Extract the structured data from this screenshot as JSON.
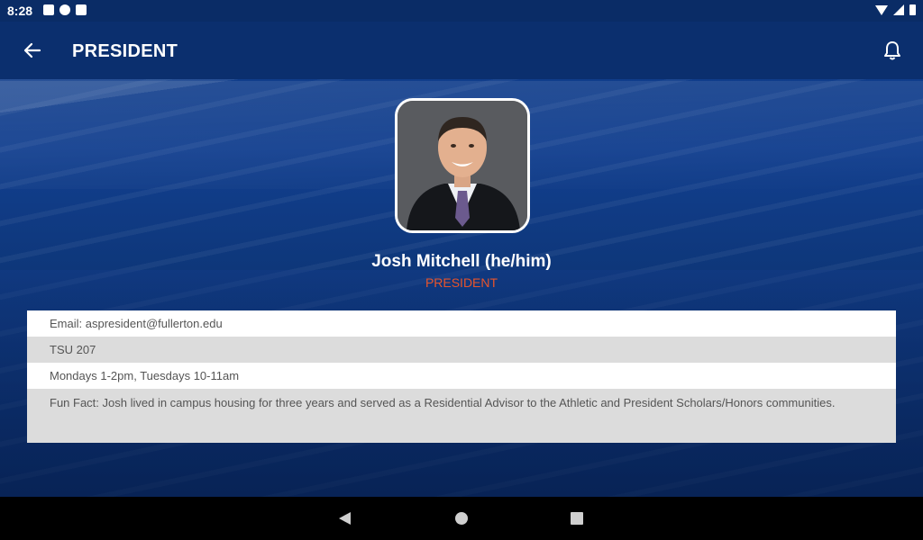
{
  "status_bar": {
    "time": "8:28",
    "left_icons": [
      "notification-a-icon",
      "notification-o-icon",
      "sd-card-icon"
    ],
    "right_icons": [
      "wifi-icon",
      "signal-icon",
      "battery-icon"
    ]
  },
  "app_bar": {
    "title": "PRESIDENT",
    "back_icon": "arrow-left-icon",
    "action_icon": "bell-icon"
  },
  "profile": {
    "name": "Josh Mitchell (he/him)",
    "role": "PRESIDENT"
  },
  "details": {
    "email": "Email: aspresident@fullerton.edu",
    "office": "TSU 207",
    "hours": "Mondays 1-2pm, Tuesdays 10-11am",
    "fun_fact": "Fun Fact: Josh lived in campus housing for three years and served as a Residential Advisor to the Athletic and President Scholars/Honors communities."
  },
  "colors": {
    "app_bar": "#0b2f6e",
    "role_accent": "#e8542b",
    "row_white": "#ffffff",
    "row_gray": "#dcdcdc"
  },
  "nav_bar": {
    "icons": [
      "back-triangle-icon",
      "home-circle-icon",
      "recents-square-icon"
    ]
  }
}
